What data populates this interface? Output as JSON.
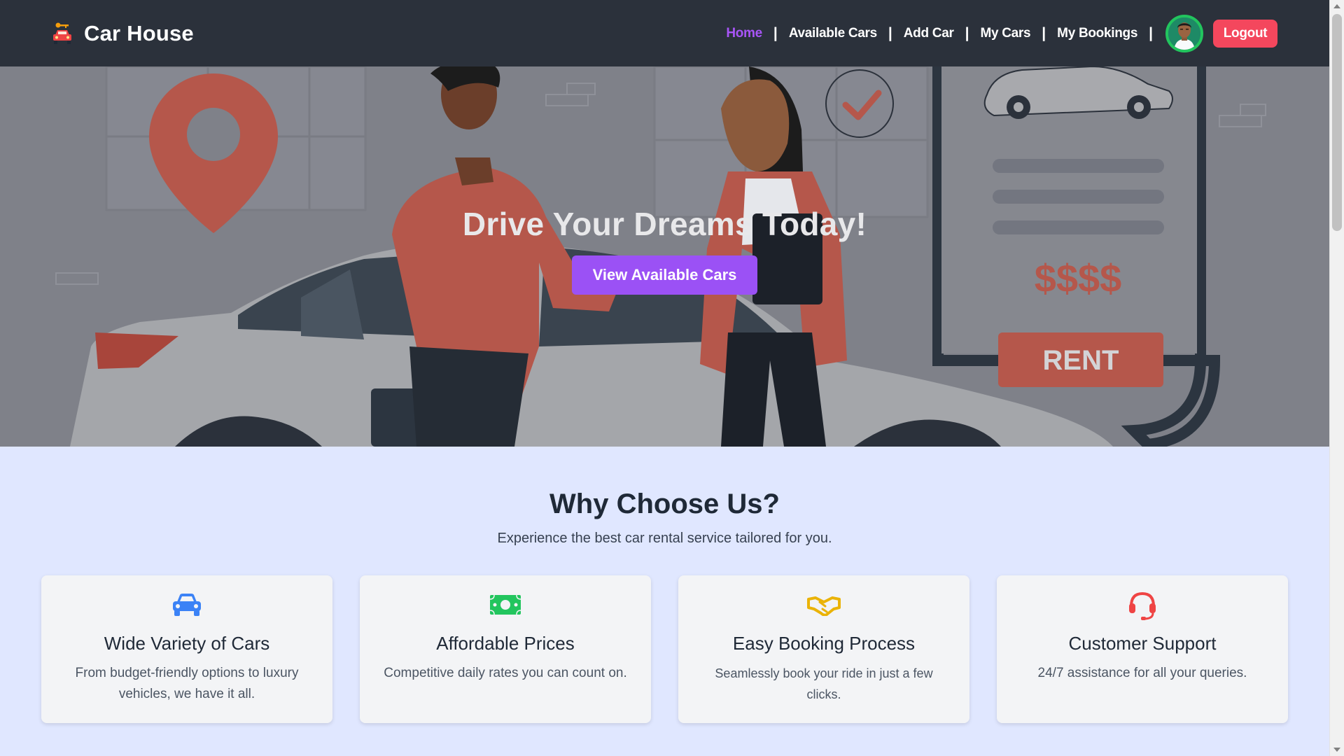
{
  "brand": {
    "name": "Car House",
    "icon": "car-key-icon"
  },
  "nav": {
    "items": [
      {
        "label": "Home",
        "active": true
      },
      {
        "label": "Available Cars",
        "active": false
      },
      {
        "label": "Add Car",
        "active": false
      },
      {
        "label": "My Cars",
        "active": false
      },
      {
        "label": "My Bookings",
        "active": false
      }
    ],
    "separator": "|",
    "logout_label": "Logout"
  },
  "hero": {
    "title": "Drive Your Dreams Today!",
    "cta_label": "View Available Cars",
    "illustration": {
      "price_sign": "$$$$",
      "rent_label": "RENT"
    }
  },
  "why": {
    "title": "Why Choose Us?",
    "subtitle": "Experience the best car rental service tailored for you.",
    "cards": [
      {
        "icon": "car-icon",
        "icon_color": "#3b82f6",
        "title": "Wide Variety of Cars",
        "description": "From budget-friendly options to luxury vehicles, we have it all."
      },
      {
        "icon": "money-icon",
        "icon_color": "#22c55e",
        "title": "Affordable Prices",
        "description": "Competitive daily rates you can count on."
      },
      {
        "icon": "handshake-icon",
        "icon_color": "#eab308",
        "title": "Easy Booking Process",
        "description": "Seamlessly book your ride in just a few clicks."
      },
      {
        "icon": "headset-icon",
        "icon_color": "#ef4444",
        "title": "Customer Support",
        "description": "24/7 assistance for all your queries."
      }
    ]
  },
  "colors": {
    "navbar": "#2b313b",
    "accent": "#a855f7",
    "cta": "#9b51f5",
    "logout": "#f4475d",
    "page_bg": "#e0e7ff",
    "illustration_red": "#b5574b"
  }
}
